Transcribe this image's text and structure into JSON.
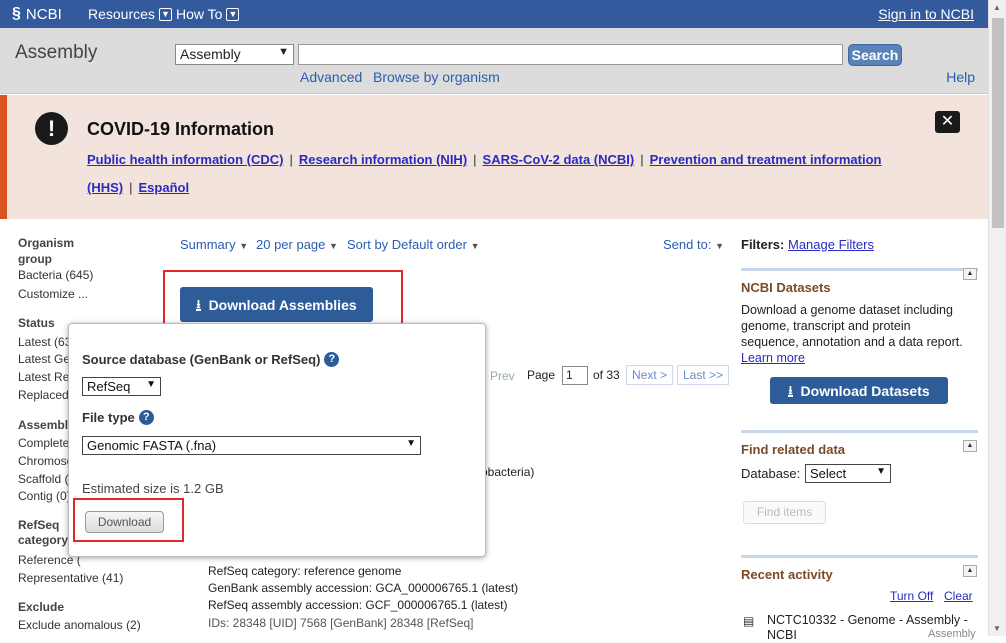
{
  "topbar": {
    "logo": "NCBI",
    "menu_resources": "Resources",
    "menu_howto": "How To",
    "signin": "Sign in to NCBI"
  },
  "search": {
    "db_title": "Assembly",
    "db_selected": "Assembly",
    "term": "",
    "button": "Search",
    "advanced": "Advanced",
    "browse": "Browse by organism",
    "help": "Help"
  },
  "alert": {
    "title": "COVID-19 Information",
    "links": [
      "Public health information (CDC)",
      "Research information (NIH)",
      "SARS-CoV-2 data (NCBI)",
      "Prevention and treatment information",
      "(HHS)",
      "Español"
    ],
    "separator": "|"
  },
  "facets": {
    "organism_group": "Organism group",
    "bacteria": "Bacteria",
    "bacteria_count": "(645)",
    "customize": "Customize ...",
    "status": "Status",
    "status_items": [
      "Latest (63",
      "Latest Ge",
      "Latest Re",
      "Replaced"
    ],
    "assembly": "Assembl",
    "assembly_items": [
      "Complete",
      "Chromoso",
      "Scaffold (",
      "Contig (0)"
    ],
    "refseq_category": "RefSeq category",
    "reference": "Reference (",
    "representative": "Representative (41)",
    "exclude": "Exclude",
    "exclude_anomalous": "Exclude anomalous (2)"
  },
  "results": {
    "summary": "Summary",
    "per_page": "20 per page",
    "sort": "Sort by Default order",
    "send_to": "Send to:",
    "prev": "Prev",
    "page_label": "Page",
    "page_value": "1",
    "of_pages": "of 33",
    "next": "Next >",
    "last": "Last >>",
    "download_assemblies": "Download Assemblies",
    "organism_fragment": "obacteria)",
    "refseq_category_line": "RefSeq category: reference genome",
    "genbank_line": "GenBank assembly accession: GCA_000006765.1 (latest)",
    "refseq_line": "RefSeq assembly accession: GCF_000006765.1 (latest)",
    "ids_line": "IDs: 28348 [UID] 7568 [GenBank] 28348 [RefSeq]"
  },
  "popup": {
    "source_label": "Source database (GenBank or RefSeq)",
    "source_value": "RefSeq",
    "filetype_label": "File type",
    "filetype_value": "Genomic FASTA (.fna)",
    "estimate": "Estimated size is 1.2 GB",
    "download": "Download",
    "help_glyph": "?"
  },
  "sidebar": {
    "filters": "Filters:",
    "manage_filters": "Manage Filters",
    "datasets_title": "NCBI Datasets",
    "datasets_desc_1": "Download a genome dataset including",
    "datasets_desc_2": "genome, transcript and protein",
    "datasets_desc_3": "sequence, annotation and a data report.",
    "learn_more": "Learn more",
    "download_datasets": "Download Datasets",
    "find_related": "Find related data",
    "database_label": "Database:",
    "database_value": "Select",
    "find_items": "Find items",
    "recent_activity": "Recent activity",
    "turn_off": "Turn Off",
    "clear": "Clear",
    "recent_item": "NCTC10332 - Genome - Assembly -",
    "recent_item_2": "NCBI",
    "recent_item_tag": "Assembly"
  },
  "colors": {
    "topbar": "#325a9c",
    "accent_button": "#2d5c98",
    "alert_bg": "#f2e4dc",
    "alert_border": "#d9531e",
    "highlight_box": "#e0272a"
  }
}
